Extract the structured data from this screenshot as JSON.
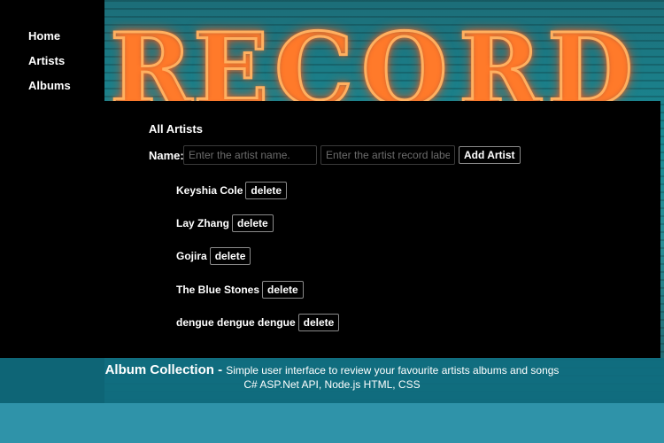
{
  "sidebar": {
    "items": [
      {
        "label": "Home"
      },
      {
        "label": "Artists"
      },
      {
        "label": "Albums"
      }
    ]
  },
  "background": {
    "sign_text": "RECORD"
  },
  "artists_panel": {
    "title": "All Artists",
    "name_label": "Name:",
    "name_placeholder": "Enter the artist name.",
    "label_placeholder": "Enter the artist record label",
    "add_button_label": "Add Artist",
    "delete_label": "delete",
    "artists": [
      {
        "name": "Keyshia Cole"
      },
      {
        "name": "Lay Zhang"
      },
      {
        "name": "Gojira"
      },
      {
        "name": "The Blue Stones"
      },
      {
        "name": "dengue dengue dengue"
      }
    ]
  },
  "caption": {
    "title": "Album Collection",
    "separator": " - ",
    "description": "Simple user interface to review your favourite artists albums and songs",
    "tech": "C# ASP.Net API, Node.js HTML, CSS"
  },
  "colors": {
    "caption_band": "#0f6e80",
    "bottom_band": "#2f93a9",
    "neon": "#ff5a1f"
  }
}
